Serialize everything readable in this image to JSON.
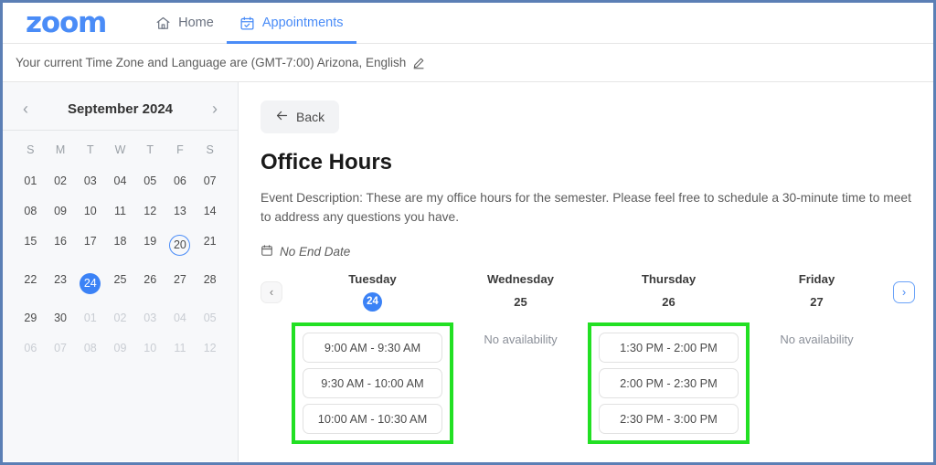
{
  "nav": {
    "logo": "zoom",
    "tabs": [
      {
        "label": "Home",
        "icon": "home-icon",
        "active": false
      },
      {
        "label": "Appointments",
        "icon": "calendar-check-icon",
        "active": true
      }
    ]
  },
  "timezone_bar": {
    "text": "Your current Time Zone and Language are (GMT-7:00) Arizona, English",
    "edit_icon": "pencil-icon"
  },
  "sidebar": {
    "calendar": {
      "title": "September 2024",
      "prev_label": "‹",
      "next_label": "›",
      "day_headers": [
        "S",
        "M",
        "T",
        "W",
        "T",
        "F",
        "S"
      ],
      "weeks": [
        [
          {
            "d": "01",
            "muted": false
          },
          {
            "d": "02",
            "muted": false
          },
          {
            "d": "03",
            "muted": false
          },
          {
            "d": "04",
            "muted": false
          },
          {
            "d": "05",
            "muted": false
          },
          {
            "d": "06",
            "muted": false
          },
          {
            "d": "07",
            "muted": false
          }
        ],
        [
          {
            "d": "08",
            "muted": false
          },
          {
            "d": "09",
            "muted": false
          },
          {
            "d": "10",
            "muted": false
          },
          {
            "d": "11",
            "muted": false
          },
          {
            "d": "12",
            "muted": false
          },
          {
            "d": "13",
            "muted": false
          },
          {
            "d": "14",
            "muted": false
          }
        ],
        [
          {
            "d": "15",
            "muted": false
          },
          {
            "d": "16",
            "muted": false
          },
          {
            "d": "17",
            "muted": false
          },
          {
            "d": "18",
            "muted": false
          },
          {
            "d": "19",
            "muted": false
          },
          {
            "d": "20",
            "muted": false,
            "today": true
          },
          {
            "d": "21",
            "muted": false
          }
        ],
        [
          {
            "d": "22",
            "muted": false
          },
          {
            "d": "23",
            "muted": false
          },
          {
            "d": "24",
            "muted": false,
            "selected": true
          },
          {
            "d": "25",
            "muted": false
          },
          {
            "d": "26",
            "muted": false
          },
          {
            "d": "27",
            "muted": false
          },
          {
            "d": "28",
            "muted": false
          }
        ],
        [
          {
            "d": "29",
            "muted": false
          },
          {
            "d": "30",
            "muted": false
          },
          {
            "d": "01",
            "muted": true
          },
          {
            "d": "02",
            "muted": true
          },
          {
            "d": "03",
            "muted": true
          },
          {
            "d": "04",
            "muted": true
          },
          {
            "d": "05",
            "muted": true
          }
        ],
        [
          {
            "d": "06",
            "muted": true
          },
          {
            "d": "07",
            "muted": true
          },
          {
            "d": "08",
            "muted": true
          },
          {
            "d": "09",
            "muted": true
          },
          {
            "d": "10",
            "muted": true
          },
          {
            "d": "11",
            "muted": true
          },
          {
            "d": "12",
            "muted": true
          }
        ]
      ]
    }
  },
  "main": {
    "back_label": "Back",
    "title": "Office Hours",
    "description": "Event Description: These are my office hours for the semester. Please feel free to schedule a 30-minute time to meet to address any questions you have.",
    "end_date_label": "No End Date",
    "end_date_icon": "calendar-icon",
    "pager_prev": "‹",
    "pager_next": "›",
    "no_availability_label": "No availability",
    "days": [
      {
        "name": "Tuesday",
        "number": "24",
        "selected": true,
        "highlighted": true,
        "slots": [
          "9:00 AM - 9:30 AM",
          "9:30 AM - 10:00 AM",
          "10:00 AM - 10:30 AM"
        ]
      },
      {
        "name": "Wednesday",
        "number": "25",
        "selected": false,
        "highlighted": false,
        "slots": []
      },
      {
        "name": "Thursday",
        "number": "26",
        "selected": false,
        "highlighted": true,
        "slots": [
          "1:30 PM - 2:00 PM",
          "2:00 PM - 2:30 PM",
          "2:30 PM - 3:00 PM"
        ]
      },
      {
        "name": "Friday",
        "number": "27",
        "selected": false,
        "highlighted": false,
        "slots": []
      }
    ]
  },
  "colors": {
    "brand_blue": "#4a8cf7",
    "selected_blue": "#3b82f6",
    "highlight_green": "#22e023",
    "page_border": "#5b7fb5"
  }
}
